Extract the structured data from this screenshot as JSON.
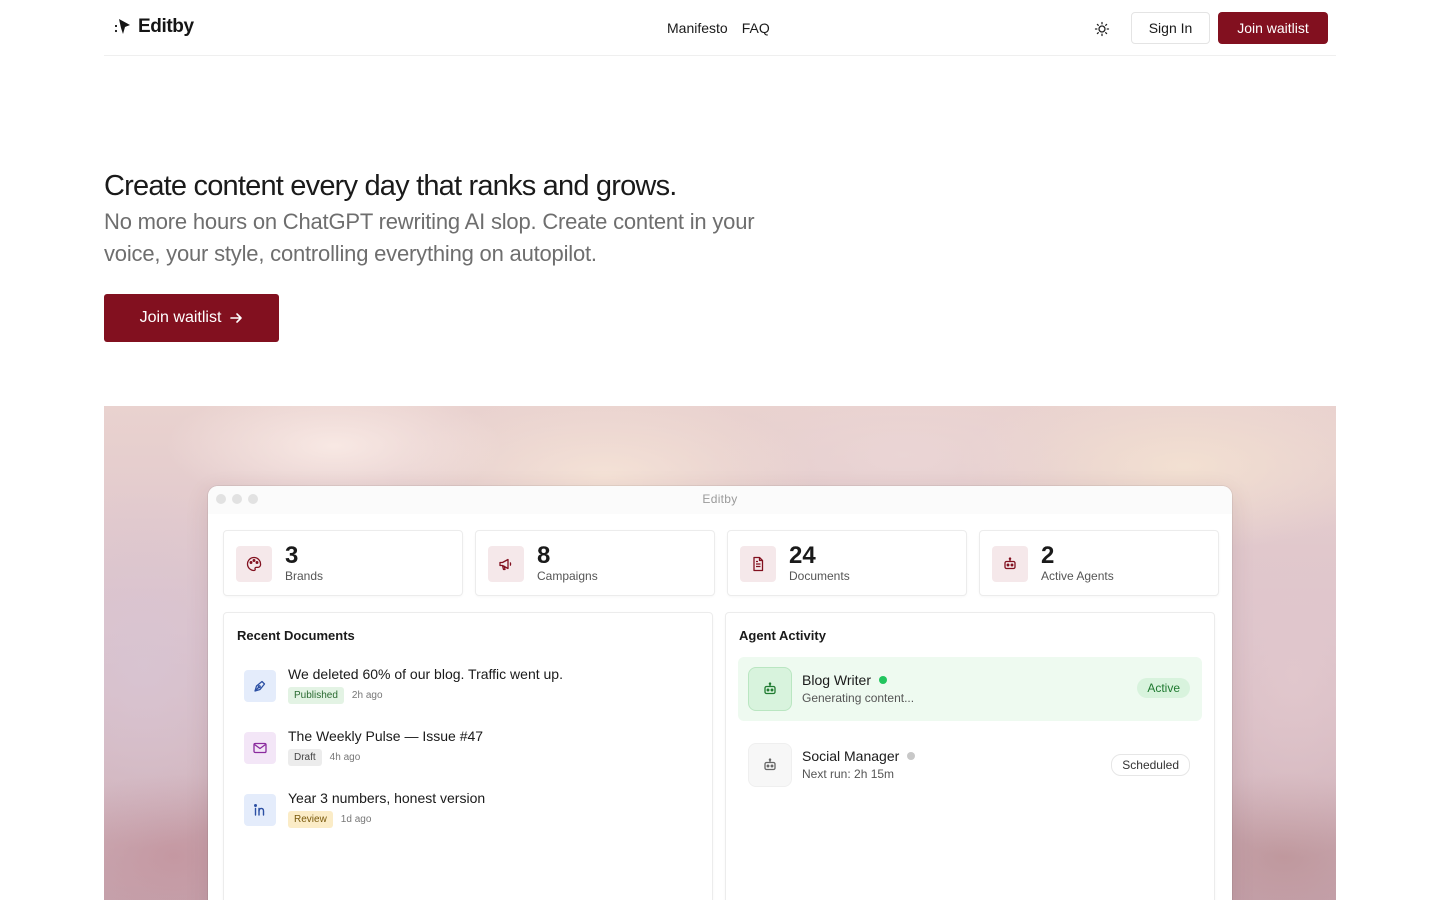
{
  "nav": {
    "logo_text": "Editby",
    "links": [
      "Manifesto",
      "FAQ"
    ],
    "signin_label": "Sign In",
    "join_label": "Join waitlist"
  },
  "hero": {
    "title": "Create content every day that ranks and grows.",
    "subtitle": "No more hours on ChatGPT rewriting AI slop. Create content in your voice, your style, controlling everything on autopilot.",
    "cta_label": "Join waitlist"
  },
  "app": {
    "window_title": "Editby",
    "stats": [
      {
        "value": "3",
        "label": "Brands",
        "icon": "palette-icon"
      },
      {
        "value": "8",
        "label": "Campaigns",
        "icon": "megaphone-icon"
      },
      {
        "value": "24",
        "label": "Documents",
        "icon": "document-icon"
      },
      {
        "value": "2",
        "label": "Active Agents",
        "icon": "bot-icon"
      }
    ],
    "recent_documents": {
      "title": "Recent Documents",
      "items": [
        {
          "title": "We deleted 60% of our blog. Traffic went up.",
          "status": "Published",
          "time": "2h ago",
          "icon": "pen-icon"
        },
        {
          "title": "The Weekly Pulse — Issue #47",
          "status": "Draft",
          "time": "4h ago",
          "icon": "mail-icon"
        },
        {
          "title": "Year 3 numbers, honest version",
          "status": "Review",
          "time": "1d ago",
          "icon": "linkedin-icon"
        }
      ]
    },
    "agent_activity": {
      "title": "Agent Activity",
      "agents": [
        {
          "name": "Blog Writer",
          "detail": "Generating content...",
          "status": "Active"
        },
        {
          "name": "Social Manager",
          "detail": "Next run: 2h 15m",
          "status": "Scheduled"
        }
      ]
    }
  },
  "colors": {
    "brand": "#82101f",
    "active_green": "#1f7a30",
    "active_dot": "#22c55e",
    "idle_dot": "#c8c8c8"
  }
}
